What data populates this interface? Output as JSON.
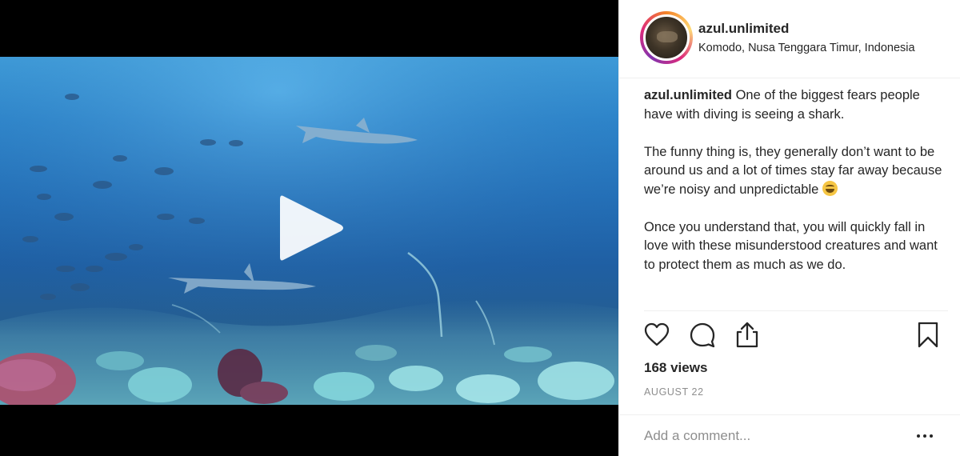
{
  "post": {
    "username": "azul.unlimited",
    "location": "Komodo, Nusa Tenggara Timur, Indonesia",
    "caption": {
      "user": "azul.unlimited",
      "paragraph1": " One of the biggest fears people have with diving is seeing a shark.",
      "paragraph2": "The funny thing is, they generally don’t want to be around us and a lot of times stay far away because we’re noisy and unpredictable ",
      "paragraph2_emoji": "tears-of-joy-emoji",
      "paragraph3": "Once you understand that, you will quickly fall in love with these misunderstood creatures and want to protect them as much as we do."
    },
    "views": "168 views",
    "date": "AUGUST 22",
    "comment_placeholder": "Add a comment..."
  },
  "icons": {
    "play": "play-icon",
    "like": "heart-icon",
    "comment": "comment-icon",
    "share": "share-icon",
    "save": "bookmark-icon",
    "more": "more-options-icon"
  },
  "colors": {
    "text": "#262626",
    "muted": "#8e8e8e",
    "divider": "#efefef",
    "video_background": "#000000"
  }
}
